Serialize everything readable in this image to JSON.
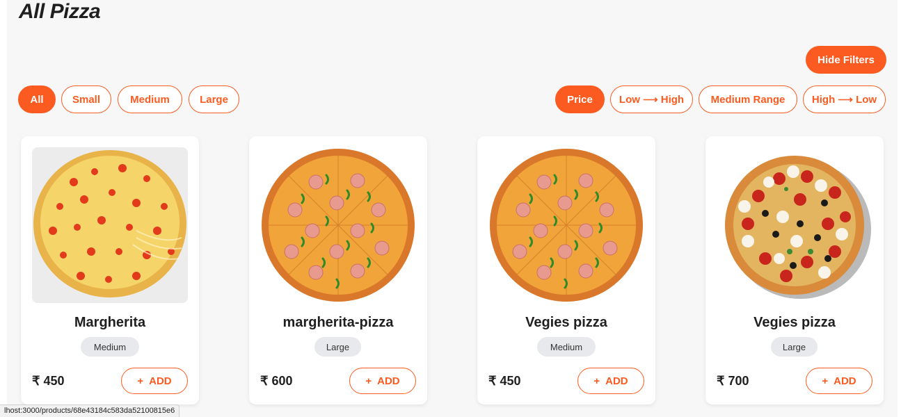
{
  "page": {
    "title": "All Pizza"
  },
  "actions": {
    "hide_filters": "Hide Filters"
  },
  "size_filters": [
    {
      "label": "All",
      "active": true
    },
    {
      "label": "Small",
      "active": false
    },
    {
      "label": "Medium",
      "active": false
    },
    {
      "label": "Large",
      "active": false
    }
  ],
  "price_filters": [
    {
      "label": "Price",
      "active": true
    },
    {
      "label": "Low ⟶ High",
      "active": false
    },
    {
      "label": "Medium Range",
      "active": false
    },
    {
      "label": "High ⟶ Low",
      "active": false
    }
  ],
  "products": [
    {
      "name": "Margherita",
      "size": "Medium",
      "price": "₹ 450",
      "add_label": "ADD",
      "add_icon": "+",
      "image": "cheese-tomato-pizza"
    },
    {
      "name": "margherita-pizza",
      "size": "Large",
      "price": "₹ 600",
      "add_label": "ADD",
      "add_icon": "+",
      "image": "sausage-pepper-pizza"
    },
    {
      "name": "Vegies pizza",
      "size": "Medium",
      "price": "₹ 450",
      "add_label": "ADD",
      "add_icon": "+",
      "image": "sausage-pepper-pizza"
    },
    {
      "name": "Vegies pizza",
      "size": "Large",
      "price": "₹ 700",
      "add_label": "ADD",
      "add_icon": "+",
      "image": "pepperoni-mozzarella-pizza"
    }
  ],
  "status_bar": {
    "url": "lhost:3000/products/68e43184c583da52100815e6"
  },
  "colors": {
    "accent": "#fb5b20",
    "background": "#f7f7f7",
    "card": "#ffffff",
    "badge": "#e8e9ec"
  }
}
